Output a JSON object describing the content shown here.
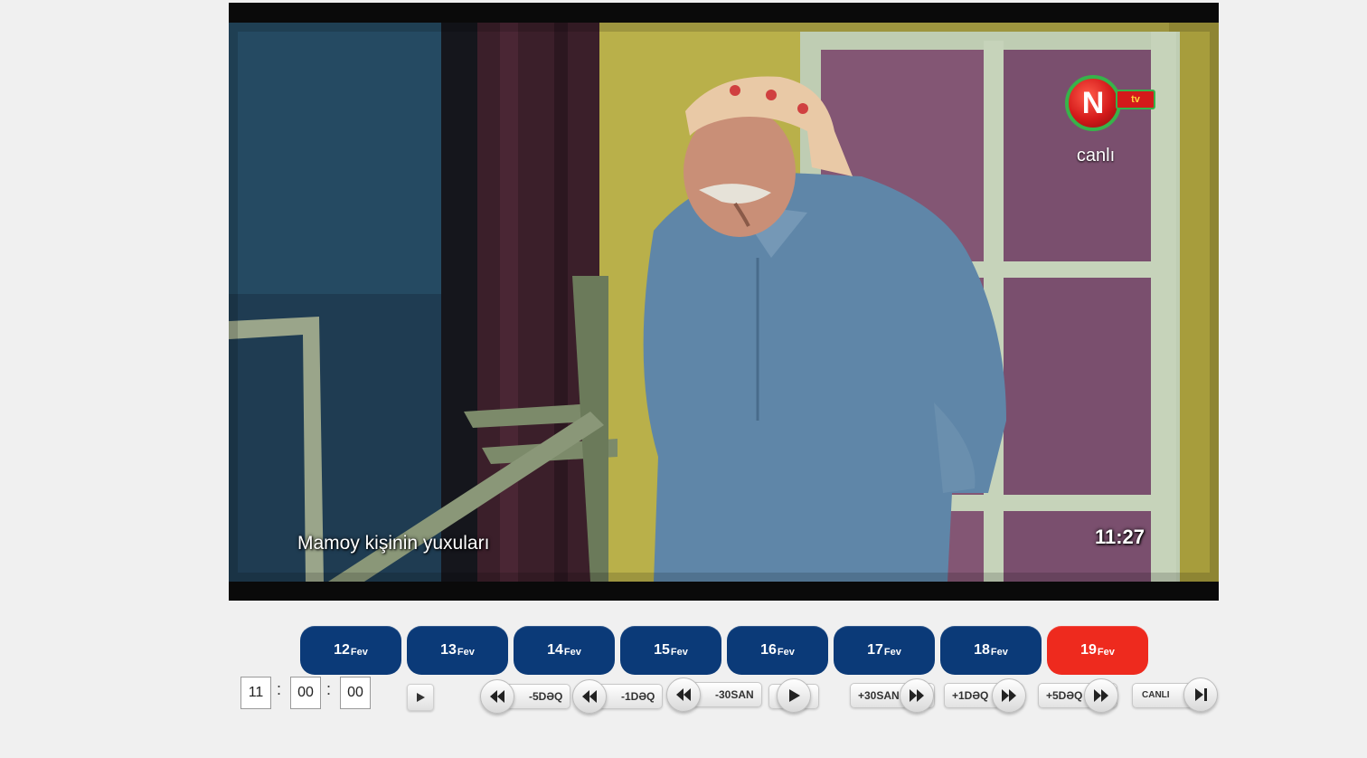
{
  "video": {
    "program_title": "Mamoy kişinin yuxuları",
    "clock": "11:27",
    "channel_logo_letter": "N",
    "channel_logo_tv": "tv",
    "live_label": "canlı"
  },
  "days": [
    {
      "day": "12",
      "month": "Fev",
      "active": false
    },
    {
      "day": "13",
      "month": "Fev",
      "active": false
    },
    {
      "day": "14",
      "month": "Fev",
      "active": false
    },
    {
      "day": "15",
      "month": "Fev",
      "active": false
    },
    {
      "day": "16",
      "month": "Fev",
      "active": false
    },
    {
      "day": "17",
      "month": "Fev",
      "active": false
    },
    {
      "day": "18",
      "month": "Fev",
      "active": false
    },
    {
      "day": "19",
      "month": "Fev",
      "active": true
    }
  ],
  "time": {
    "hours": "11",
    "minutes": "00",
    "seconds": "00",
    "separator": ":"
  },
  "controls": {
    "back_5min": "-5DƏQ",
    "back_1min": "-1DƏQ",
    "back_30sec": "-30SAN",
    "fwd_30sec": "+30SAN",
    "fwd_1min": "+1DƏQ",
    "fwd_5min": "+5DƏQ",
    "live": "CANLI"
  },
  "colors": {
    "day_button": "#0b3a78",
    "day_button_active": "#ee2a1e",
    "page_background": "#f0f0f0"
  }
}
